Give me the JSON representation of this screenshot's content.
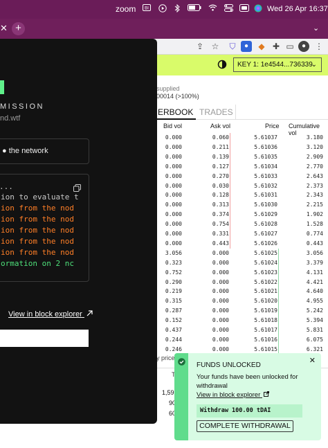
{
  "menubar": {
    "app_name": "zoom",
    "datetime": "Wed 26 Apr  16:37",
    "icons": [
      "screen-share-icon",
      "play-icon",
      "bluetooth-icon",
      "battery-icon",
      "wifi-icon",
      "control-center-icon",
      "siri-icon"
    ]
  },
  "app": {
    "theme_icon": "half-moon-icon",
    "key_selector": "KEY 1: 1e4544...736339",
    "supplied_label": "supplied",
    "supplied_value": "00014 (>100%)",
    "tabs": [
      "ERBOOK",
      "TRADES"
    ],
    "orderbook": {
      "columns": [
        "Bid vol",
        "Ask vol",
        "Price",
        "Cumulative vol"
      ],
      "rows": [
        [
          "0.000",
          "0.060",
          "5.61037",
          "3.180"
        ],
        [
          "0.000",
          "0.211",
          "5.61036",
          "3.120"
        ],
        [
          "0.000",
          "0.139",
          "5.61035",
          "2.909"
        ],
        [
          "0.000",
          "0.127",
          "5.61034",
          "2.770"
        ],
        [
          "0.000",
          "0.270",
          "5.61033",
          "2.643"
        ],
        [
          "0.000",
          "0.030",
          "5.61032",
          "2.373"
        ],
        [
          "0.000",
          "0.128",
          "5.61031",
          "2.343"
        ],
        [
          "0.000",
          "0.313",
          "5.61030",
          "2.215"
        ],
        [
          "0.000",
          "0.374",
          "5.61029",
          "1.902"
        ],
        [
          "0.000",
          "0.754",
          "5.61028",
          "1.528"
        ],
        [
          "0.000",
          "0.331",
          "5.61027",
          "0.774"
        ],
        [
          "0.000",
          "0.443",
          "5.61026",
          "0.443"
        ],
        [
          "3.056",
          "0.000",
          "5.61025",
          "3.056"
        ],
        [
          "0.323",
          "0.000",
          "5.61024",
          "3.379"
        ],
        [
          "0.752",
          "0.000",
          "5.61023",
          "4.131"
        ],
        [
          "0.290",
          "0.000",
          "5.61022",
          "4.421"
        ],
        [
          "0.219",
          "0.000",
          "5.61021",
          "4.640"
        ],
        [
          "0.315",
          "0.000",
          "5.61020",
          "4.955"
        ],
        [
          "0.287",
          "0.000",
          "5.61019",
          "5.242"
        ],
        [
          "0.152",
          "0.000",
          "5.61018",
          "5.394"
        ],
        [
          "0.437",
          "0.000",
          "5.61017",
          "5.831"
        ],
        [
          "0.244",
          "0.000",
          "5.61016",
          "6.075"
        ],
        [
          "0.246",
          "0.000",
          "5.61015",
          "6.321"
        ]
      ]
    },
    "prices_fragment": "y prices",
    "trades_fragment": {
      "header": "T",
      "values": [
        "1,599",
        "90",
        "60"
      ]
    }
  },
  "modal": {
    "heading": "MISSION",
    "url": "nd.wtf",
    "network_label": "the network",
    "console_header": "...",
    "console_lines": [
      {
        "text": "ion to evaluate t",
        "color": "#c9c9c9"
      },
      {
        "text": "ion from the nod",
        "color": "#ff7f27"
      },
      {
        "text": "ion from the nod",
        "color": "#ff7f27"
      },
      {
        "text": "ion from the nod",
        "color": "#ff7f27"
      },
      {
        "text": "ion from the nod",
        "color": "#ff7f27"
      },
      {
        "text": "ion from the nod",
        "color": "#ff7f27"
      },
      {
        "text": "ormation on 2 nc",
        "color": "#4ee07a"
      }
    ],
    "explorer_link": "View in block explorer"
  },
  "toast": {
    "title": "FUNDS UNLOCKED",
    "body": "Your funds have been unlocked for withdrawal",
    "link": "View in block explorer",
    "withdraw_text": "Withdraw 100.00 tDAI",
    "button": "COMPLETE WITHDRAWAL"
  },
  "colors": {
    "menubar": "#6a1c58",
    "accent_lime": "#d9fb6a",
    "modal_bg": "#121212",
    "toast_bg": "#d8fbe4",
    "toast_accent": "#60dc8c",
    "console_orange": "#ff7f27",
    "console_green": "#4ee07a"
  }
}
